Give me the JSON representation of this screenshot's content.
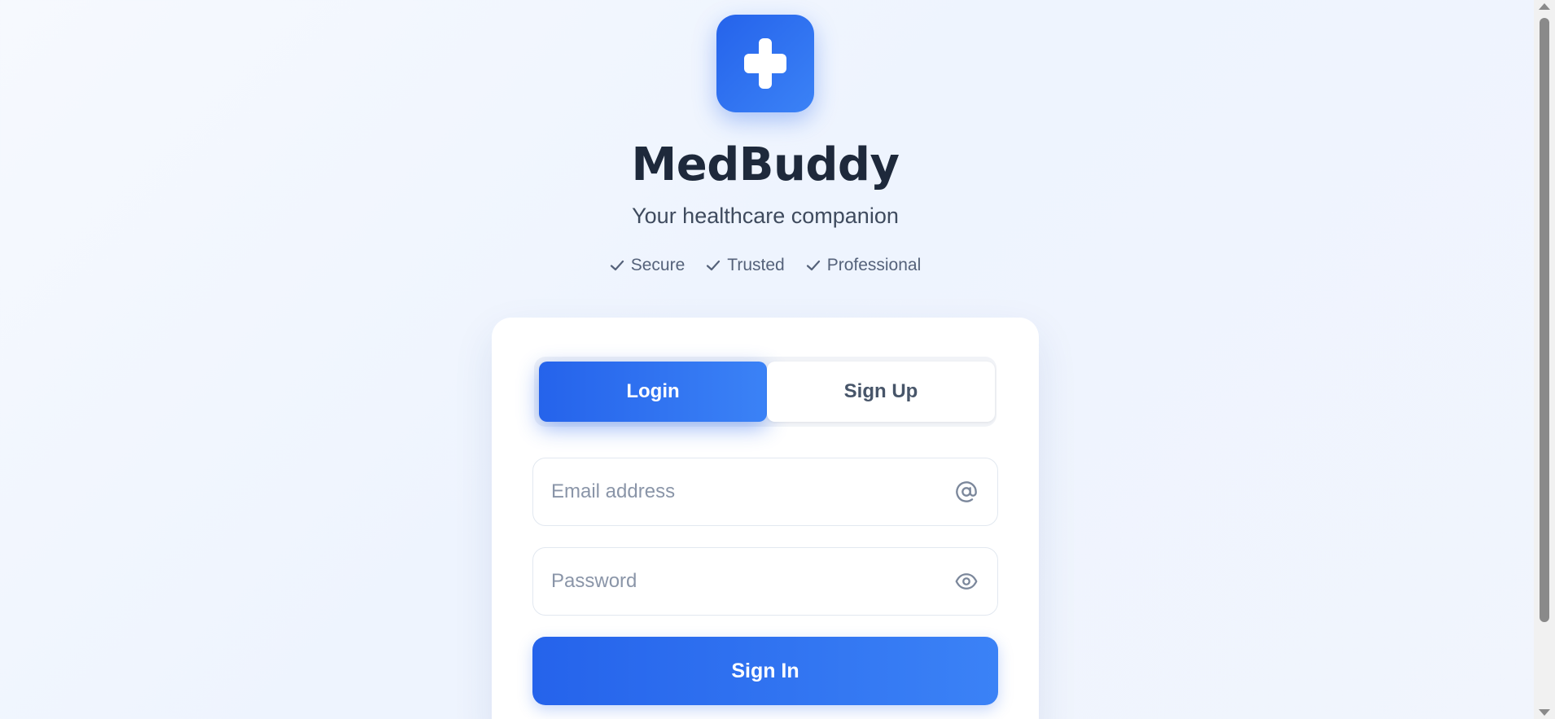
{
  "app": {
    "title": "MedBuddy",
    "subtitle": "Your healthcare companion",
    "logo_icon": "medical-cross-icon"
  },
  "features": [
    {
      "label": "Secure",
      "icon": "check-icon"
    },
    {
      "label": "Trusted",
      "icon": "check-icon"
    },
    {
      "label": "Professional",
      "icon": "check-icon"
    }
  ],
  "tabs": {
    "login_label": "Login",
    "signup_label": "Sign Up",
    "active": "login"
  },
  "form": {
    "email": {
      "value": "",
      "placeholder": "Email address",
      "icon": "at-sign-icon"
    },
    "password": {
      "value": "",
      "placeholder": "Password",
      "icon": "eye-icon"
    },
    "submit_label": "Sign In"
  },
  "colors": {
    "primary": "#2563eb",
    "primary_light": "#3b82f6",
    "heading": "#1e293b",
    "muted": "#55627a",
    "background": "#eef4fe"
  }
}
